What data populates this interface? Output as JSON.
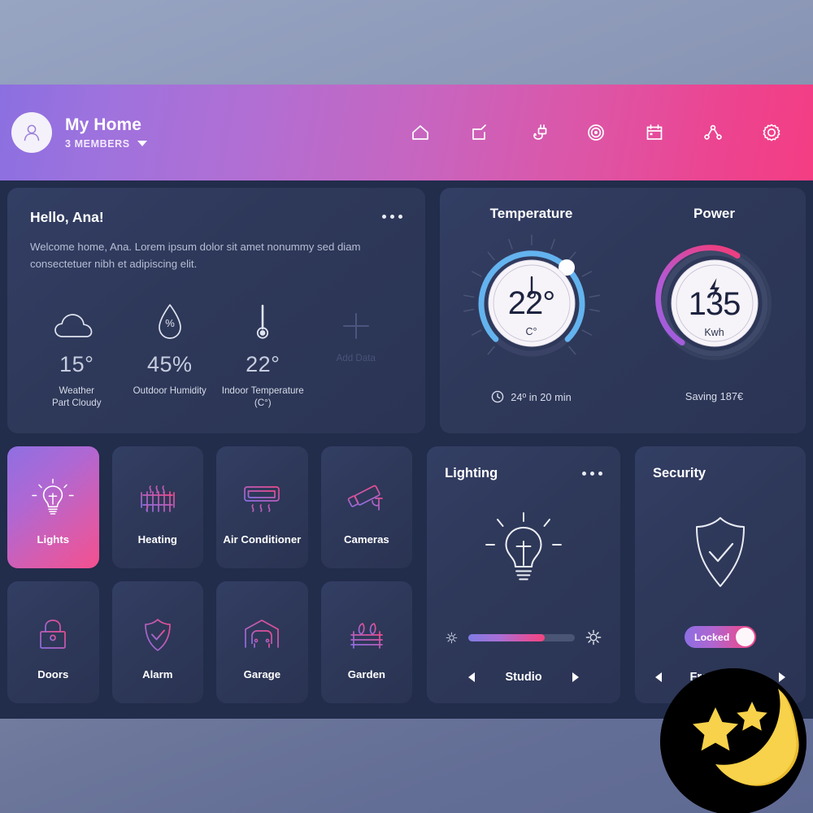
{
  "header": {
    "home_title": "My Home",
    "members": "3 MEMBERS",
    "avatar_icon": "user-avatar-icon",
    "caret_icon": "chevron-down-icon",
    "nav": [
      {
        "name": "home",
        "icon": "home-icon"
      },
      {
        "name": "rooms",
        "icon": "share-upload-icon"
      },
      {
        "name": "devices",
        "icon": "plug-icon"
      },
      {
        "name": "automation",
        "icon": "target-icon"
      },
      {
        "name": "schedule",
        "icon": "calendar-icon"
      },
      {
        "name": "network",
        "icon": "share-nodes-icon"
      },
      {
        "name": "settings",
        "icon": "gear-icon"
      }
    ]
  },
  "welcome": {
    "greeting": "Hello, Ana!",
    "body": "Welcome home, Ana. Lorem ipsum dolor sit amet nonummy sed diam consectetuer nibh et adipiscing elit.",
    "menu_icon": "more-options-icon",
    "stats": [
      {
        "icon": "cloud-icon",
        "value": "15°",
        "label": "Weather\nPart Cloudy",
        "muted": false
      },
      {
        "icon": "humidity-drop-icon",
        "value": "45%",
        "label": "Outdoor Humidity",
        "muted": false
      },
      {
        "icon": "thermometer-icon",
        "value": "22°",
        "label": "Indoor Temperature\n(C°)",
        "muted": false
      },
      {
        "icon": "plus-icon",
        "value": "",
        "label": "Add Data",
        "muted": true
      }
    ]
  },
  "temperature": {
    "title": "Temperature",
    "value": "22°",
    "unit": "C°",
    "icon": "thermometer-icon",
    "footer_icon": "clock-icon",
    "footer": "24º in 20 min",
    "arc_percent": 72,
    "arc_color": "#63b3ef"
  },
  "power": {
    "title": "Power",
    "value": "135",
    "unit": "Kwh",
    "icon": "lightning-bolt-icon",
    "footer": "Saving 187€",
    "arc_percent": 62,
    "arc_color_start": "#9b5fe0",
    "arc_color_end": "#ec3f83"
  },
  "devices": [
    {
      "label": "Lights",
      "icon": "lightbulb-icon",
      "active": true
    },
    {
      "label": "Heating",
      "icon": "radiator-icon",
      "active": false
    },
    {
      "label": "Air Conditioner",
      "icon": "air-conditioner-icon",
      "active": false
    },
    {
      "label": "Cameras",
      "icon": "cctv-camera-icon",
      "active": false
    },
    {
      "label": "Doors",
      "icon": "padlock-icon",
      "active": false
    },
    {
      "label": "Alarm",
      "icon": "shield-check-icon",
      "active": false
    },
    {
      "label": "Garage",
      "icon": "garage-car-icon",
      "active": false
    },
    {
      "label": "Garden",
      "icon": "garden-bench-icon",
      "active": false
    }
  ],
  "lighting": {
    "title": "Lighting",
    "menu_icon": "more-options-icon",
    "bulb_icon": "lightbulb-icon",
    "brightness_percent": 72,
    "low_icon": "brightness-low-icon",
    "high_icon": "brightness-high-icon",
    "room": "Studio",
    "prev_icon": "arrow-left-icon",
    "next_icon": "arrow-right-icon"
  },
  "security": {
    "title": "Security",
    "shield_icon": "shield-check-icon",
    "toggle_label": "Locked",
    "toggle_on": true,
    "zone": "Front Door",
    "prev_icon": "arrow-left-icon",
    "next_icon": "arrow-right-icon"
  },
  "night_badge": {
    "icon": "crescent-moon-stars-icon",
    "moon_color": "#f7d24a",
    "bg_color": "#000000"
  },
  "colors": {
    "header_gradient_start": "#8b6fe0",
    "header_gradient_end": "#f43d83",
    "dashboard_bg": "#222c4b",
    "card_bg": "#303a5e",
    "accent_purple": "#9b5fe0",
    "accent_pink": "#ec3f83",
    "accent_blue": "#63b3ef"
  }
}
